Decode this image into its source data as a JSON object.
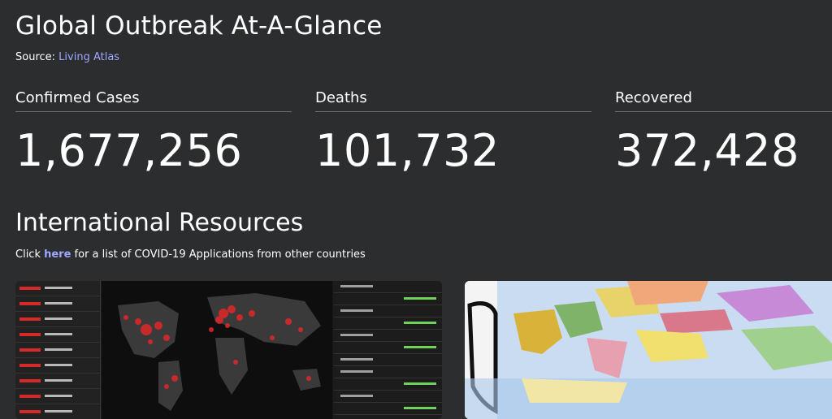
{
  "header": {
    "title": "Global Outbreak At-A-Glance",
    "source_prefix": "Source: ",
    "source_link": "Living Atlas"
  },
  "stats": [
    {
      "label": "Confirmed Cases",
      "value": "1,677,256"
    },
    {
      "label": "Deaths",
      "value": "101,732"
    },
    {
      "label": "Recovered",
      "value": "372,428"
    }
  ],
  "resources": {
    "title": "International Resources",
    "text_before": "Click ",
    "link": "here",
    "text_after": " for a list of COVID-19 Applications from other countries"
  },
  "colors": {
    "background": "#2b2d2e",
    "link": "#9fa7ff",
    "accent_red": "#d42a2a"
  }
}
